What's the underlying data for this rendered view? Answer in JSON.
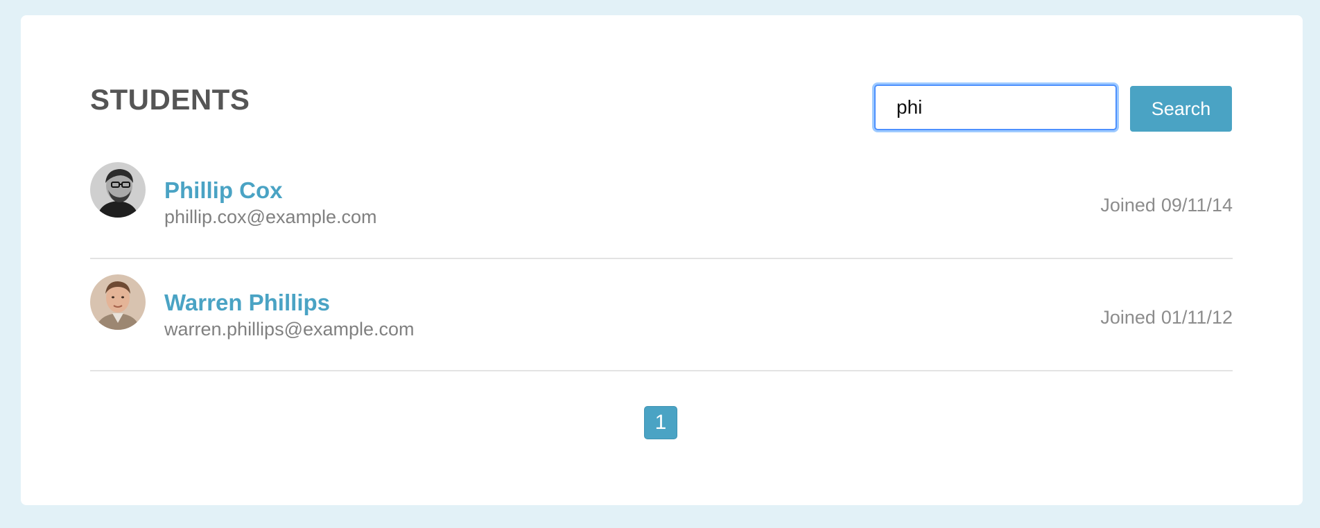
{
  "header": {
    "title": "STUDENTS"
  },
  "search": {
    "value": "phi",
    "button_label": "Search"
  },
  "students": [
    {
      "name": "Phillip Cox",
      "email": "phillip.cox@example.com",
      "joined_label": "Joined",
      "joined_date": "09/11/14"
    },
    {
      "name": "Warren Phillips",
      "email": "warren.phillips@example.com",
      "joined_label": "Joined",
      "joined_date": "01/11/12"
    }
  ],
  "pagination": {
    "pages": [
      "1"
    ],
    "current": "1"
  },
  "colors": {
    "page_background": "#e2f1f7",
    "accent": "#4aa3c4",
    "focus_ring": "#4d90fe",
    "title": "#555555",
    "muted_text": "#808080"
  }
}
